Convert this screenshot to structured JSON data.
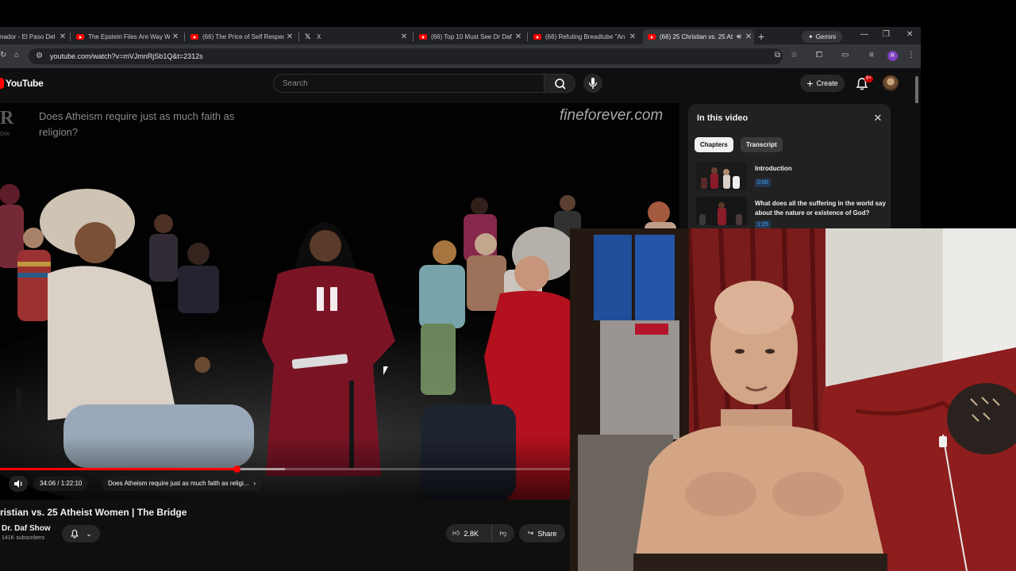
{
  "browser": {
    "tabs": [
      {
        "title": "nador - El Paso Del",
        "icon": "youtube-icon",
        "active": false
      },
      {
        "title": "The Epstein Files Are Way W",
        "icon": "youtube-icon",
        "active": false
      },
      {
        "title": "(66) The Price of Self Respect",
        "icon": "youtube-icon",
        "active": false
      },
      {
        "title": "X",
        "icon": "x-icon",
        "active": false
      },
      {
        "title": "(66) Top 10 Must See Dr Daf",
        "icon": "youtube-icon",
        "active": false
      },
      {
        "title": "(66) Refuting Breadtube \"An",
        "icon": "youtube-icon",
        "active": false
      },
      {
        "title": "(66) 25 Christian vs. 25 At",
        "icon": "youtube-icon",
        "active": true
      }
    ],
    "gemini_label": "Gemini",
    "url": "youtube.com/watch?v=mVJmnRjSb1Q&t=2312s",
    "profile_initial": "R"
  },
  "youtube": {
    "logo_text": "YouTube",
    "search_placeholder": "Search",
    "create_label": "Create",
    "notification_count": "9+"
  },
  "player": {
    "overlay_question": "Does Atheism require just as much faith as religion?",
    "overlay_logo_letter": "R",
    "overlay_logo_sub": "OW",
    "watermark": "fineforever.com",
    "current_time": "34:06",
    "duration": "1:22:10",
    "time_display": "34:06 / 1:22:10",
    "chapter_label": "Does Atheism require just as much faith as religi...",
    "progress_fraction": 0.415,
    "buffered_fraction": 0.5,
    "state": "playing"
  },
  "video": {
    "title": "ristian vs. 25 Atheist Women | The Bridge",
    "channel": "Dr. Daf Show",
    "subscribers": "141K subscribers",
    "likes": "2.8K",
    "share_label": "Share"
  },
  "chapters_panel": {
    "title": "In this video",
    "tabs": [
      "Chapters",
      "Transcript"
    ],
    "active_tab": "Chapters",
    "chapters": [
      {
        "title": "Introduction",
        "time": "0:00"
      },
      {
        "title": "What does all the suffering in the world say about the nature or existence of God?",
        "time": "1:25"
      }
    ]
  },
  "colors": {
    "youtube_red": "#ff0000",
    "page_bg": "#0f0f0f",
    "chrome_tabstrip": "#202124",
    "chrome_toolbar": "#35363a",
    "chapter_time_blue": "#3ea6ff"
  }
}
